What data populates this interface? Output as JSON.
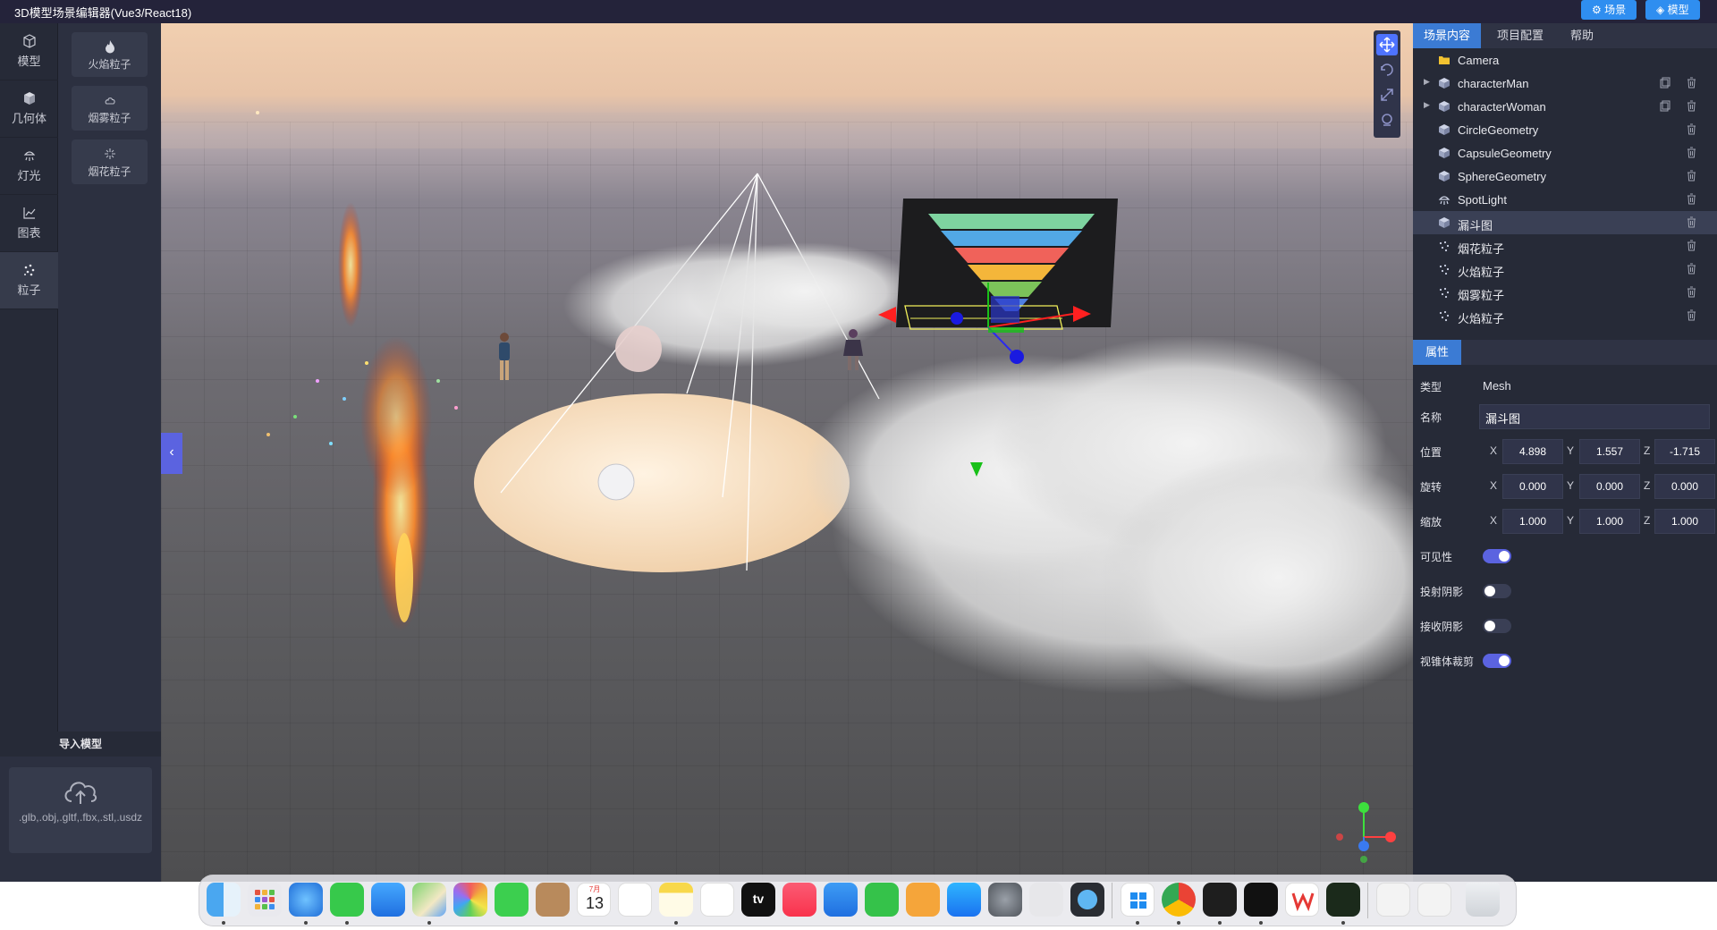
{
  "app": {
    "title": "3D模型场景编辑器(Vue3/React18)"
  },
  "topbar": {
    "scene_label": "场景",
    "model_label": "模型"
  },
  "leftnav": {
    "items": [
      {
        "label": "模型",
        "icon": "cube-icon"
      },
      {
        "label": "几何体",
        "icon": "solid-cube-icon"
      },
      {
        "label": "灯光",
        "icon": "light-icon"
      },
      {
        "label": "图表",
        "icon": "chart-icon"
      },
      {
        "label": "粒子",
        "icon": "particles-icon"
      }
    ],
    "active": "粒子"
  },
  "subpanel": {
    "items": [
      {
        "label": "火焰粒子",
        "icon": "flame-icon"
      },
      {
        "label": "烟雾粒子",
        "icon": "smoke-icon"
      },
      {
        "label": "烟花粒子",
        "icon": "firework-icon"
      }
    ]
  },
  "import": {
    "title": "导入模型",
    "formats": ".glb,.obj,.gltf,.fbx,.stl,.usdz"
  },
  "rightpanel": {
    "tabs": [
      "场景内容",
      "项目配置",
      "帮助"
    ],
    "active_tab": "场景内容",
    "tree": [
      {
        "label": "Camera",
        "icon": "camera-icon"
      },
      {
        "label": "characterMan",
        "icon": "mesh-icon",
        "expandable": true
      },
      {
        "label": "characterWoman",
        "icon": "mesh-icon",
        "expandable": true
      },
      {
        "label": "CircleGeometry",
        "icon": "mesh-icon"
      },
      {
        "label": "CapsuleGeometry",
        "icon": "mesh-icon"
      },
      {
        "label": "SphereGeometry",
        "icon": "mesh-icon"
      },
      {
        "label": "SpotLight",
        "icon": "light-icon"
      },
      {
        "label": "漏斗图",
        "icon": "mesh-icon",
        "selected": true
      },
      {
        "label": "烟花粒子",
        "icon": "particles-icon"
      },
      {
        "label": "火焰粒子",
        "icon": "particles-icon"
      },
      {
        "label": "烟雾粒子",
        "icon": "particles-icon"
      },
      {
        "label": "火焰粒子",
        "icon": "particles-icon"
      }
    ],
    "props_title": "属性",
    "props": {
      "type_label": "类型",
      "type_value": "Mesh",
      "name_label": "名称",
      "name_value": "漏斗图",
      "position_label": "位置",
      "position": [
        "4.898",
        "1.557",
        "-1.715"
      ],
      "rotation_label": "旋转",
      "rotation": [
        "0.000",
        "0.000",
        "0.000"
      ],
      "scale_label": "缩放",
      "scale": [
        "1.000",
        "1.000",
        "1.000"
      ],
      "axes": [
        "X",
        "Y",
        "Z"
      ],
      "visible_label": "可见性",
      "visible": true,
      "cast_shadow_label": "投射阴影",
      "cast_shadow": false,
      "receive_shadow_label": "接收阴影",
      "receive_shadow": false,
      "frustum_label": "视锥体裁剪",
      "frustum": true
    }
  },
  "dock": {
    "apps": [
      "Finder",
      "Launchpad",
      "Safari",
      "Messages",
      "Mail",
      "Maps",
      "Photos",
      "FaceTime",
      "Contacts",
      "Calendar",
      "Reminders",
      "Notes",
      "Freeform",
      "TV",
      "Music",
      "Keynote",
      "Numbers",
      "Pages",
      "App Store",
      "System Settings",
      "iPhone Mirroring",
      "QuickTime",
      "Windows App",
      "Chrome",
      "Terminal",
      "Unity Hub",
      "WPS",
      "Activity Monitor",
      "Preview",
      "Screenshot",
      "Trash"
    ],
    "calendar_month": "7月",
    "calendar_day": "13",
    "tv_label": "tv"
  },
  "colors": {
    "accent": "#5b63e0",
    "tab_active": "#3b7bd4",
    "panel_bg": "#262a37"
  }
}
